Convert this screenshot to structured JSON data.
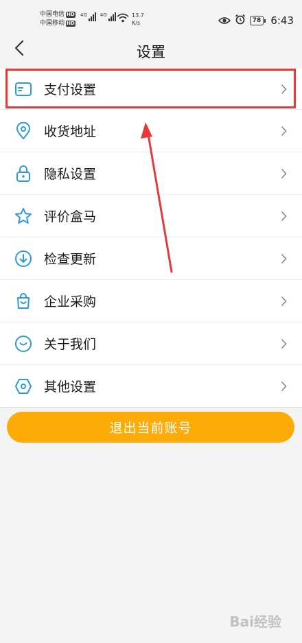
{
  "status_bar": {
    "carrier1": "中国电信",
    "carrier2": "中国移动",
    "hd_badge": "HD",
    "net_type": "4G",
    "speed_value": "13.7",
    "speed_unit": "K/s",
    "battery": "78",
    "time": "6:43"
  },
  "nav": {
    "title": "设置",
    "back_icon": "chevron-left-icon"
  },
  "menu": {
    "items": [
      {
        "label": "支付设置",
        "icon": "card-icon"
      },
      {
        "label": "收货地址",
        "icon": "location-pin-icon"
      },
      {
        "label": "隐私设置",
        "icon": "lock-icon"
      },
      {
        "label": "评价盒马",
        "icon": "star-icon"
      },
      {
        "label": "检查更新",
        "icon": "download-circle-icon"
      },
      {
        "label": "企业采购",
        "icon": "shopping-bag-icon"
      },
      {
        "label": "关于我们",
        "icon": "smile-icon"
      },
      {
        "label": "其他设置",
        "icon": "hexagon-icon"
      }
    ]
  },
  "logout_label": "退出当前账号",
  "watermark": "Bai经验",
  "colors": {
    "accent_icon": "#2a9bd8",
    "logout_bg": "#fdab08",
    "annotation_red": "#e53a3a"
  }
}
